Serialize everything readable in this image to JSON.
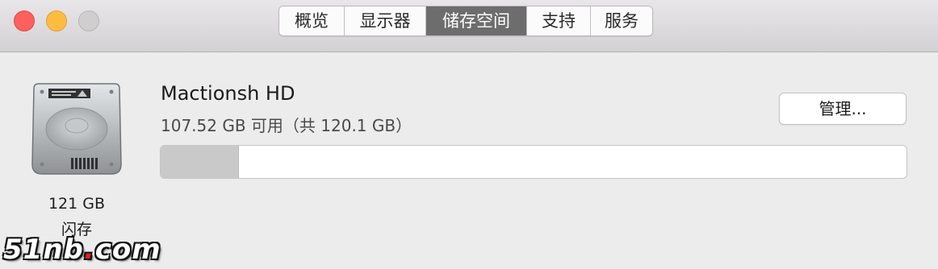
{
  "window": {
    "tabs": [
      {
        "label": "概览",
        "active": false
      },
      {
        "label": "显示器",
        "active": false
      },
      {
        "label": "储存空间",
        "active": true
      },
      {
        "label": "支持",
        "active": false
      },
      {
        "label": "服务",
        "active": false
      }
    ]
  },
  "storage": {
    "drive_icon": "hard-drive-icon",
    "drive_size": "121 GB",
    "drive_type": "闪存",
    "disk_name": "Mactionsh HD",
    "available_text": "107.52 GB 可用（共 120.1 GB）",
    "used_fraction": 0.105,
    "manage_label": "管理..."
  },
  "watermark": {
    "left": "51nb",
    "dot": ".",
    "right": "com"
  },
  "colors": {
    "close": "#fc605c",
    "minimize": "#fdbc40",
    "zoom_inactive": "#d0cecf",
    "active_tab": "#6e6d6e",
    "usage_fill": "#c9c9c9"
  }
}
